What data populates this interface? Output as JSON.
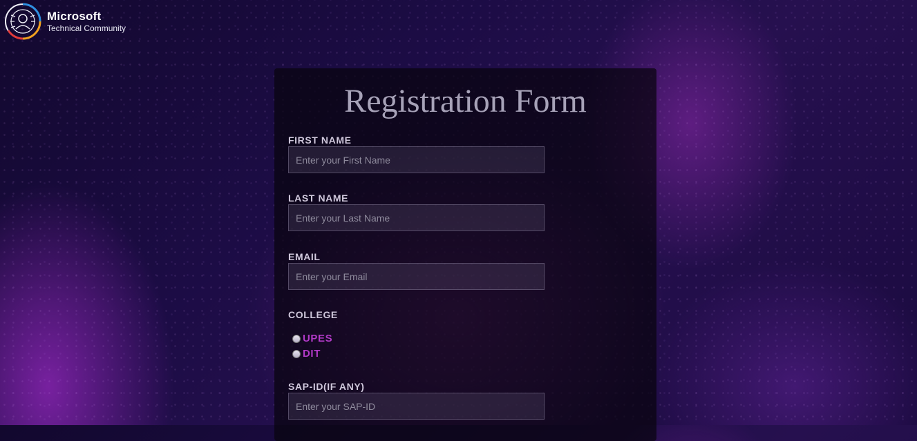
{
  "brand": {
    "title": "Microsoft",
    "subtitle": "Technical Community"
  },
  "form": {
    "title": "Registration Form",
    "fields": [
      {
        "label": "FIRST NAME",
        "placeholder": "Enter your First Name",
        "value": ""
      },
      {
        "label": "LAST NAME",
        "placeholder": "Enter your Last Name",
        "value": ""
      },
      {
        "label": "EMAIL",
        "placeholder": "Enter your Email",
        "value": ""
      },
      {
        "label": "SAP-ID(IF ANY)",
        "placeholder": "Enter your SAP-ID",
        "value": ""
      }
    ],
    "college": {
      "label": "COLLEGE",
      "options": [
        "UPES",
        "DIT"
      ],
      "selected": null
    }
  },
  "colors": {
    "accent_option": "#b23ac8",
    "label": "#d0c8dc",
    "title": "#a7a2b8"
  }
}
